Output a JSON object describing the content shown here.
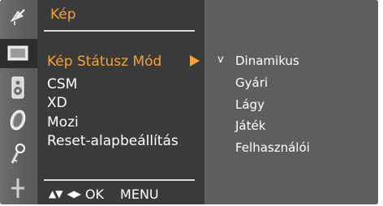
{
  "menu": {
    "title": "Kép",
    "items": [
      {
        "label": "Kép Státusz Mód",
        "selected": true
      },
      {
        "label": "CSM",
        "selected": false
      },
      {
        "label": "XD",
        "selected": false
      },
      {
        "label": "Mozi",
        "selected": false
      },
      {
        "label": "Reset-alapbeállítás",
        "selected": false
      }
    ]
  },
  "sidebar": {
    "icons": [
      "satellite-dish-icon",
      "picture-screen-icon",
      "speaker-icon",
      "clock-icon",
      "key-icon",
      "plus-settings-icon"
    ],
    "active_index": 1
  },
  "submenu": {
    "check_symbol": "v",
    "options": [
      "Dinamikus",
      "Gyári",
      "Lágy",
      "Játék",
      "Felhasználói"
    ],
    "checked_index": 0
  },
  "footer": {
    "updown_symbol": "▲▼",
    "leftright_symbol": "◀▶",
    "ok_label": "OK",
    "menu_label": "MENU"
  },
  "colors": {
    "accent": "#f4a23a",
    "panel_dark": "#3a3a3a",
    "panel_mid": "#5e5e5e",
    "text": "#ffffff"
  }
}
